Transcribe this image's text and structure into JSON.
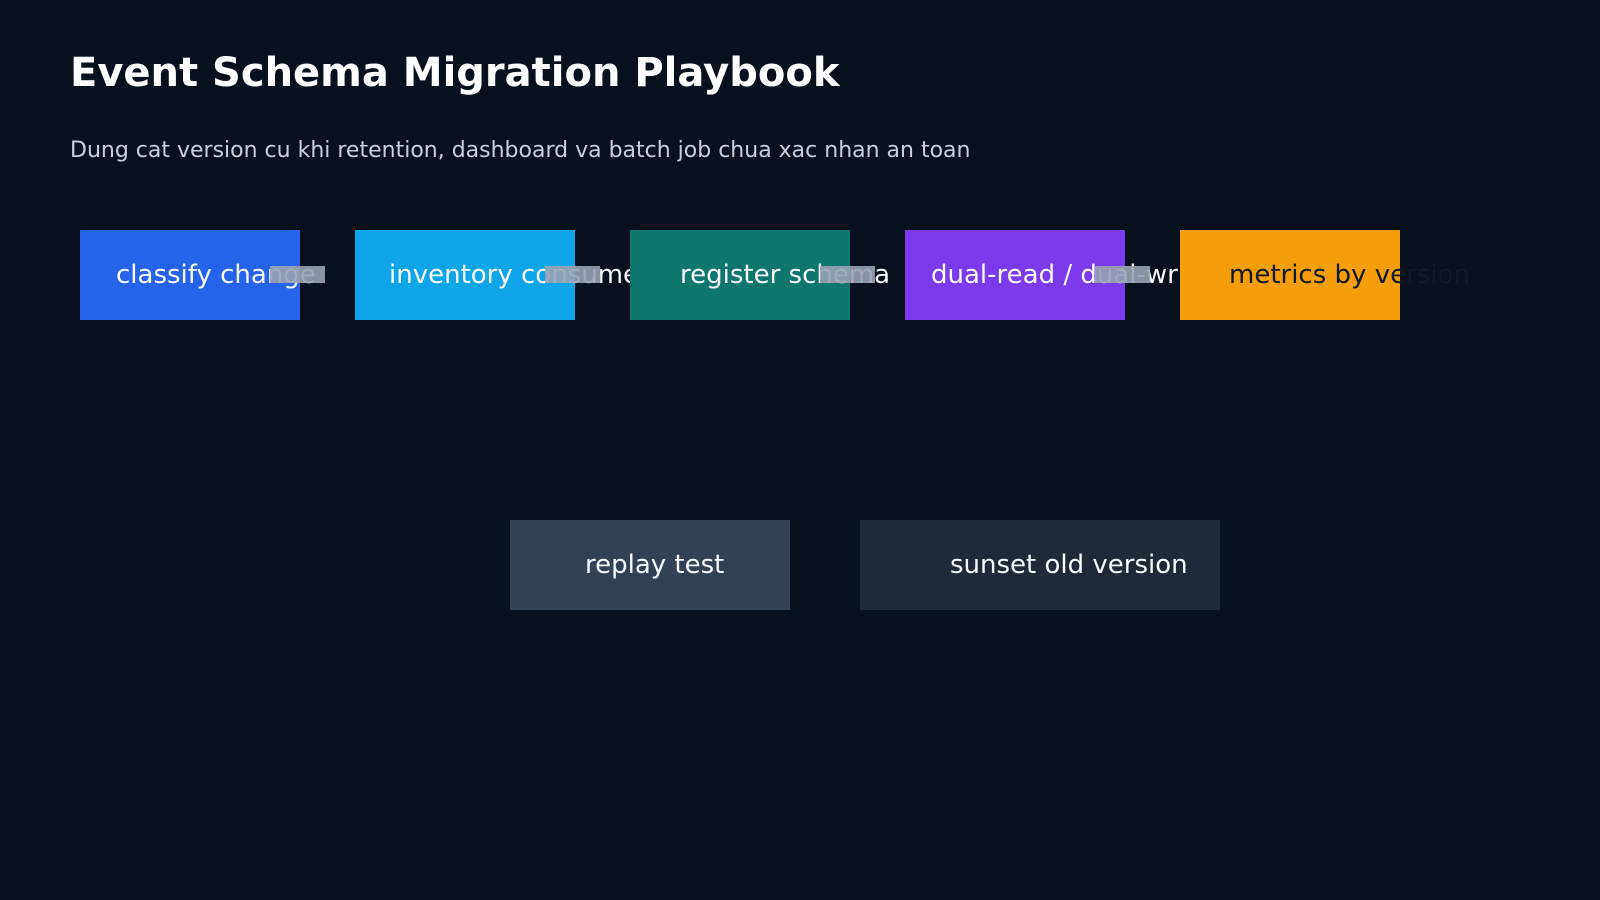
{
  "title": "Event Schema Migration Playbook",
  "subtitle": "Dung cat version cu khi retention, dashboard va batch job chua xac nhan an toan",
  "steps": [
    {
      "label": "classify change",
      "color": "#2563eb",
      "text_color": "#f8fafc"
    },
    {
      "label": "inventory consumers",
      "color": "#0ea5e9",
      "text_color": "#f8fafc"
    },
    {
      "label": "register schema",
      "color": "#0f766e",
      "text_color": "#f8fafc"
    },
    {
      "label": "dual-read / dual-write",
      "color": "#7c3aed",
      "text_color": "#f8fafc"
    },
    {
      "label": "metrics by version",
      "color": "#f59e0b",
      "text_color": "#111827"
    }
  ],
  "secondary_steps": [
    {
      "label": "replay test",
      "color": "#334155",
      "text_color": "#f8fafc"
    },
    {
      "label": "sunset old version",
      "color": "#1f2937",
      "text_color": "#f8fafc"
    }
  ],
  "colors": {
    "background": "#07101c",
    "connector": "#98a2b3"
  }
}
